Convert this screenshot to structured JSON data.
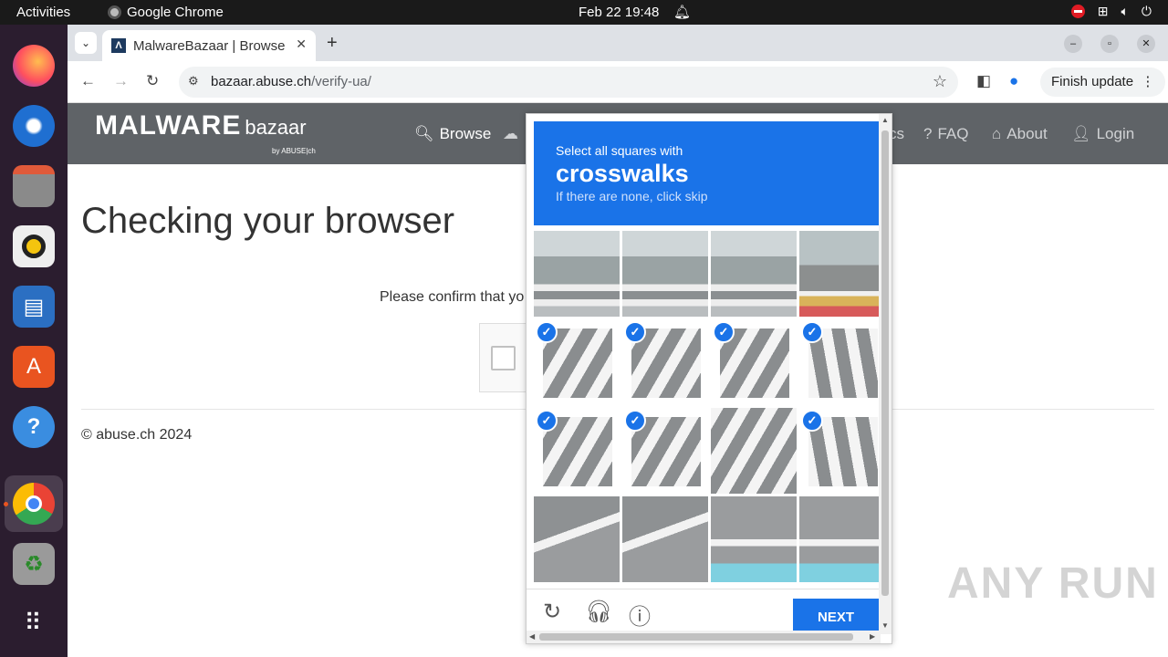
{
  "topbar": {
    "activities": "Activities",
    "app_name": "Google Chrome",
    "clock": "Feb 22  19:48"
  },
  "browser": {
    "tab_title": "MalwareBazaar | Browse",
    "url_host": "bazaar.abuse.ch",
    "url_path": "/verify-ua/",
    "finish_update": "Finish update"
  },
  "site": {
    "logo_main": "MALWARE",
    "logo_sub": "bazaar",
    "logo_by": "by ABUSE|ch",
    "nav": [
      {
        "label": "Browse"
      },
      {
        "label": "cs"
      },
      {
        "label": "FAQ"
      },
      {
        "label": "About"
      },
      {
        "label": "Login"
      }
    ],
    "heading": "Checking your browser",
    "confirm_text": "Please confirm that yo",
    "footer": "© abuse.ch 2024"
  },
  "captcha": {
    "instruction": "Select all squares with",
    "target": "crosswalks",
    "hint": "If there are none, click skip",
    "next_label": "NEXT",
    "selected": [
      false,
      false,
      false,
      false,
      true,
      true,
      true,
      true,
      true,
      true,
      false,
      true,
      false,
      false,
      false,
      false
    ]
  },
  "watermark": "ANY RUN"
}
